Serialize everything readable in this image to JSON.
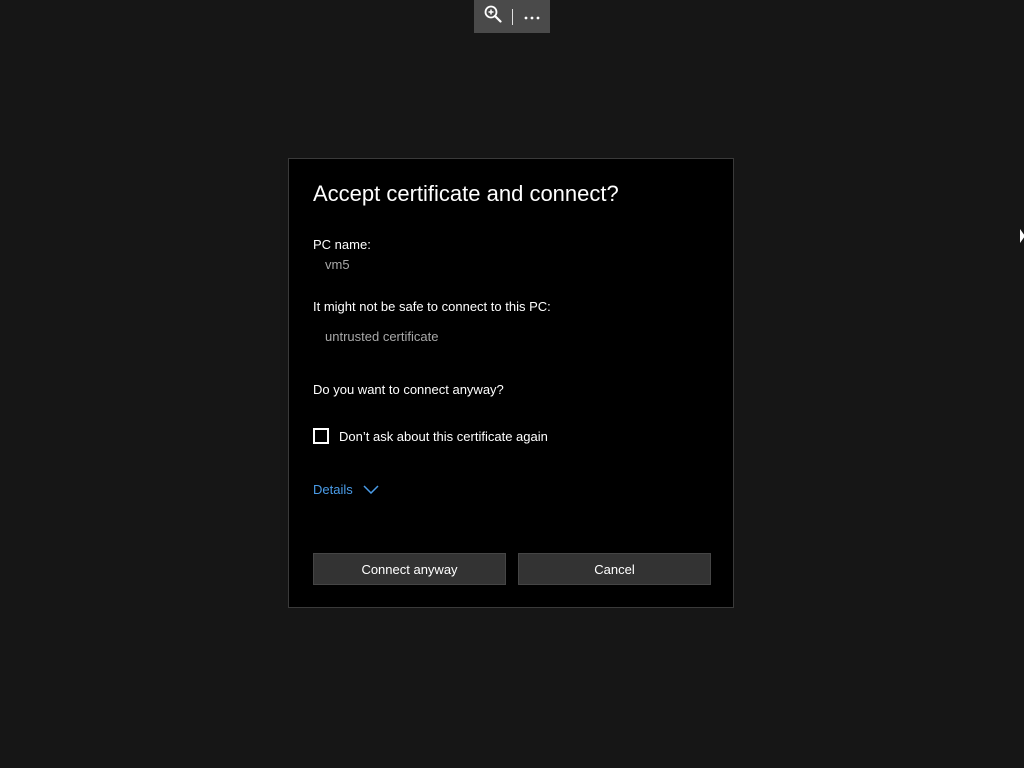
{
  "toolbar": {
    "icons": [
      "zoom-in-icon",
      "more-icon"
    ]
  },
  "dialog": {
    "title": "Accept certificate and connect?",
    "pc_name_label": "PC name:",
    "pc_name_value": "vm5",
    "warning_label": "It might not be safe to connect to this PC:",
    "warning_value": "untrusted certificate",
    "question": "Do you want to connect anyway?",
    "checkbox_label": "Don’t ask about this certificate again",
    "checkbox_checked": false,
    "details_label": "Details",
    "connect_label": "Connect anyway",
    "cancel_label": "Cancel"
  },
  "colors": {
    "background": "#161616",
    "dialog_bg": "#000000",
    "button_bg": "#333333",
    "link": "#4a9ce8",
    "muted_text": "#a8a8a8"
  }
}
